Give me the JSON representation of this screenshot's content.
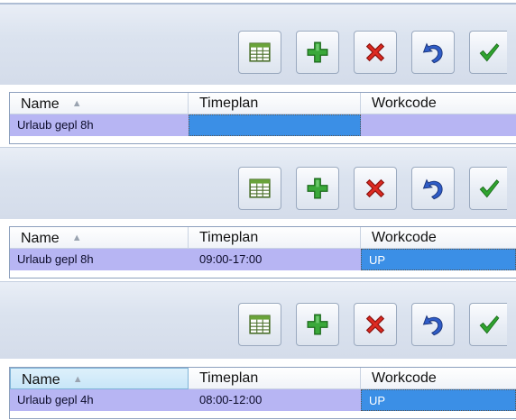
{
  "toolbar": {
    "buttons": [
      {
        "id": "grid",
        "icon": "table-grid-icon"
      },
      {
        "id": "add",
        "icon": "plus-icon",
        "color": "#2f9e2f"
      },
      {
        "id": "delete",
        "icon": "delete-x-icon",
        "color": "#d6221b"
      },
      {
        "id": "undo",
        "icon": "undo-arrow-icon",
        "color": "#2f5cc7"
      },
      {
        "id": "confirm",
        "icon": "checkmark-icon",
        "color": "#2f9e2f"
      }
    ]
  },
  "columns": {
    "name": "Name",
    "timeplan": "Timeplan",
    "workcode": "Workcode"
  },
  "panels": [
    {
      "row": {
        "name": "Urlaub gepl 8h",
        "timeplan": "",
        "workcode": ""
      }
    },
    {
      "row": {
        "name": "Urlaub gepl 8h",
        "timeplan": "09:00-17:00",
        "workcode": "UP"
      }
    },
    {
      "row": {
        "name": "Urlaub gepl 4h",
        "timeplan": "08:00-12:00",
        "workcode": "UP"
      }
    }
  ],
  "colors": {
    "row_selected": "#b7b5f3",
    "cell_editing": "#3b8fe6"
  }
}
